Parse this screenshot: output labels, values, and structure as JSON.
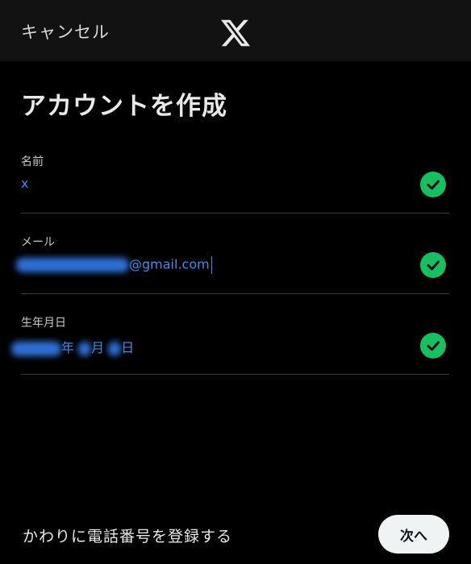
{
  "header": {
    "cancel_label": "キャンセル",
    "logo_icon": "x-logo-icon"
  },
  "page": {
    "title": "アカウントを作成"
  },
  "form": {
    "name": {
      "label": "名前",
      "value": "x",
      "status_icon": "check-circle-icon"
    },
    "email": {
      "label": "メール",
      "value_visible_suffix": "@gmail.com",
      "status_icon": "check-circle-icon"
    },
    "birthdate": {
      "label": "生年月日",
      "year_suffix": "年",
      "month_suffix": "月",
      "day_suffix": "日",
      "status_icon": "check-circle-icon"
    }
  },
  "footer": {
    "use_phone_label": "かわりに電話番号を登録する",
    "next_label": "次へ"
  },
  "colors": {
    "background": "#000000",
    "topbar": "#121212",
    "accent_blue": "#3b8ef0",
    "valid_green": "#17bf63",
    "button_bg": "#eff3f4"
  }
}
